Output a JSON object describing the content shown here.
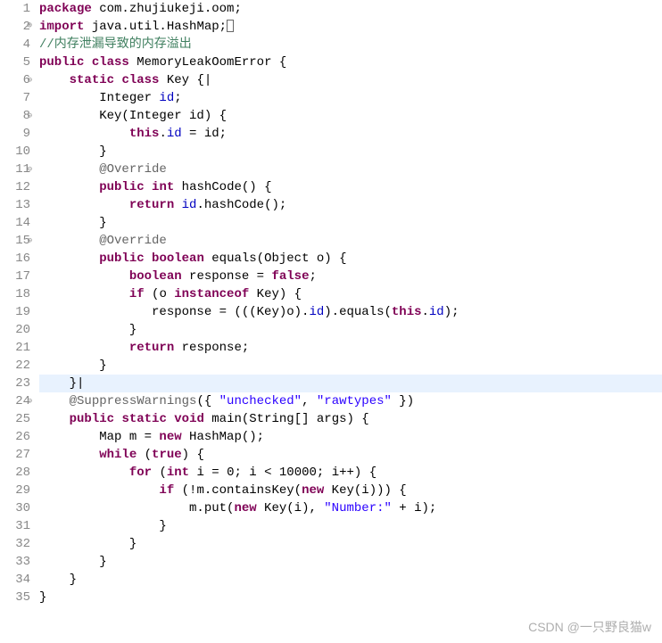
{
  "watermark": "CSDN @一只野良猫w",
  "lines": [
    {
      "num": "1",
      "fold": "",
      "html": [
        [
          "kw",
          "package"
        ],
        [
          "plain",
          " com.zhujiukeji.oom;"
        ]
      ]
    },
    {
      "num": "2",
      "fold": "plus",
      "html": [
        [
          "kw",
          "import"
        ],
        [
          "plain",
          " java.util.HashMap;"
        ],
        [
          "cursorbox",
          ""
        ]
      ]
    },
    {
      "num": "4",
      "fold": "",
      "html": [
        [
          "comment",
          "//内存泄漏导致的内存溢出"
        ]
      ]
    },
    {
      "num": "5",
      "fold": "",
      "html": [
        [
          "kw",
          "public"
        ],
        [
          "plain",
          " "
        ],
        [
          "kw",
          "class"
        ],
        [
          "plain",
          " MemoryLeakOomError {"
        ]
      ]
    },
    {
      "num": "6",
      "fold": "minus",
      "html": [
        [
          "plain",
          "    "
        ],
        [
          "kw",
          "static"
        ],
        [
          "plain",
          " "
        ],
        [
          "kw",
          "class"
        ],
        [
          "plain",
          " Key {|"
        ]
      ]
    },
    {
      "num": "7",
      "fold": "",
      "html": [
        [
          "plain",
          "        Integer "
        ],
        [
          "field",
          "id"
        ],
        [
          "plain",
          ";"
        ]
      ]
    },
    {
      "num": "8",
      "fold": "minus",
      "html": [
        [
          "plain",
          "        Key(Integer id) {"
        ]
      ]
    },
    {
      "num": "9",
      "fold": "",
      "html": [
        [
          "plain",
          "            "
        ],
        [
          "kw",
          "this"
        ],
        [
          "plain",
          "."
        ],
        [
          "field",
          "id"
        ],
        [
          "plain",
          " = id;"
        ]
      ]
    },
    {
      "num": "10",
      "fold": "",
      "html": [
        [
          "plain",
          "        }"
        ]
      ]
    },
    {
      "num": "11",
      "fold": "minus",
      "html": [
        [
          "plain",
          "        "
        ],
        [
          "annotation",
          "@Override"
        ]
      ]
    },
    {
      "num": "12",
      "fold": "",
      "html": [
        [
          "plain",
          "        "
        ],
        [
          "kw",
          "public"
        ],
        [
          "plain",
          " "
        ],
        [
          "kw",
          "int"
        ],
        [
          "plain",
          " hashCode() {"
        ]
      ]
    },
    {
      "num": "13",
      "fold": "",
      "html": [
        [
          "plain",
          "            "
        ],
        [
          "kw",
          "return"
        ],
        [
          "plain",
          " "
        ],
        [
          "field",
          "id"
        ],
        [
          "plain",
          ".hashCode();"
        ]
      ]
    },
    {
      "num": "14",
      "fold": "",
      "html": [
        [
          "plain",
          "        }"
        ]
      ]
    },
    {
      "num": "15",
      "fold": "minus",
      "html": [
        [
          "plain",
          "        "
        ],
        [
          "annotation",
          "@Override"
        ]
      ]
    },
    {
      "num": "16",
      "fold": "",
      "html": [
        [
          "plain",
          "        "
        ],
        [
          "kw",
          "public"
        ],
        [
          "plain",
          " "
        ],
        [
          "kw",
          "boolean"
        ],
        [
          "plain",
          " equals(Object o) {"
        ]
      ]
    },
    {
      "num": "17",
      "fold": "",
      "html": [
        [
          "plain",
          "            "
        ],
        [
          "kw",
          "boolean"
        ],
        [
          "plain",
          " response = "
        ],
        [
          "kw",
          "false"
        ],
        [
          "plain",
          ";"
        ]
      ]
    },
    {
      "num": "18",
      "fold": "",
      "html": [
        [
          "plain",
          "            "
        ],
        [
          "kw",
          "if"
        ],
        [
          "plain",
          " (o "
        ],
        [
          "kw",
          "instanceof"
        ],
        [
          "plain",
          " Key) {"
        ]
      ]
    },
    {
      "num": "19",
      "fold": "",
      "html": [
        [
          "plain",
          "               response = (((Key)o)."
        ],
        [
          "field",
          "id"
        ],
        [
          "plain",
          ").equals("
        ],
        [
          "kw",
          "this"
        ],
        [
          "plain",
          "."
        ],
        [
          "field",
          "id"
        ],
        [
          "plain",
          ");"
        ]
      ]
    },
    {
      "num": "20",
      "fold": "",
      "html": [
        [
          "plain",
          "            }"
        ]
      ]
    },
    {
      "num": "21",
      "fold": "",
      "html": [
        [
          "plain",
          "            "
        ],
        [
          "kw",
          "return"
        ],
        [
          "plain",
          " response;"
        ]
      ]
    },
    {
      "num": "22",
      "fold": "",
      "html": [
        [
          "plain",
          "        }"
        ]
      ]
    },
    {
      "num": "23",
      "fold": "",
      "highlight": true,
      "html": [
        [
          "plain",
          "    }|"
        ]
      ]
    },
    {
      "num": "24",
      "fold": "minus",
      "html": [
        [
          "plain",
          "    "
        ],
        [
          "annotation",
          "@SuppressWarnings"
        ],
        [
          "plain",
          "({ "
        ],
        [
          "string",
          "\"unchecked\""
        ],
        [
          "plain",
          ", "
        ],
        [
          "string",
          "\"rawtypes\""
        ],
        [
          "plain",
          " })"
        ]
      ]
    },
    {
      "num": "25",
      "fold": "",
      "html": [
        [
          "plain",
          "    "
        ],
        [
          "kw",
          "public"
        ],
        [
          "plain",
          " "
        ],
        [
          "kw",
          "static"
        ],
        [
          "plain",
          " "
        ],
        [
          "kw",
          "void"
        ],
        [
          "plain",
          " main(String[] args) {"
        ]
      ]
    },
    {
      "num": "26",
      "fold": "",
      "html": [
        [
          "plain",
          "        Map m = "
        ],
        [
          "kw",
          "new"
        ],
        [
          "plain",
          " HashMap();"
        ]
      ]
    },
    {
      "num": "27",
      "fold": "",
      "html": [
        [
          "plain",
          "        "
        ],
        [
          "kw",
          "while"
        ],
        [
          "plain",
          " ("
        ],
        [
          "kw",
          "true"
        ],
        [
          "plain",
          ") {"
        ]
      ]
    },
    {
      "num": "28",
      "fold": "",
      "html": [
        [
          "plain",
          "            "
        ],
        [
          "kw",
          "for"
        ],
        [
          "plain",
          " ("
        ],
        [
          "kw",
          "int"
        ],
        [
          "plain",
          " i = 0; i < 10000; i++) {"
        ]
      ]
    },
    {
      "num": "29",
      "fold": "",
      "html": [
        [
          "plain",
          "                "
        ],
        [
          "kw",
          "if"
        ],
        [
          "plain",
          " (!m.containsKey("
        ],
        [
          "kw",
          "new"
        ],
        [
          "plain",
          " Key(i))) {"
        ]
      ]
    },
    {
      "num": "30",
      "fold": "",
      "html": [
        [
          "plain",
          "                    m.put("
        ],
        [
          "kw",
          "new"
        ],
        [
          "plain",
          " Key(i), "
        ],
        [
          "string",
          "\"Number:\""
        ],
        [
          "plain",
          " + i);"
        ]
      ]
    },
    {
      "num": "31",
      "fold": "",
      "html": [
        [
          "plain",
          "                }"
        ]
      ]
    },
    {
      "num": "32",
      "fold": "",
      "html": [
        [
          "plain",
          "            }"
        ]
      ]
    },
    {
      "num": "33",
      "fold": "",
      "html": [
        [
          "plain",
          "        }"
        ]
      ]
    },
    {
      "num": "34",
      "fold": "",
      "html": [
        [
          "plain",
          "    }"
        ]
      ]
    },
    {
      "num": "35",
      "fold": "",
      "html": [
        [
          "plain",
          "}"
        ]
      ]
    }
  ]
}
